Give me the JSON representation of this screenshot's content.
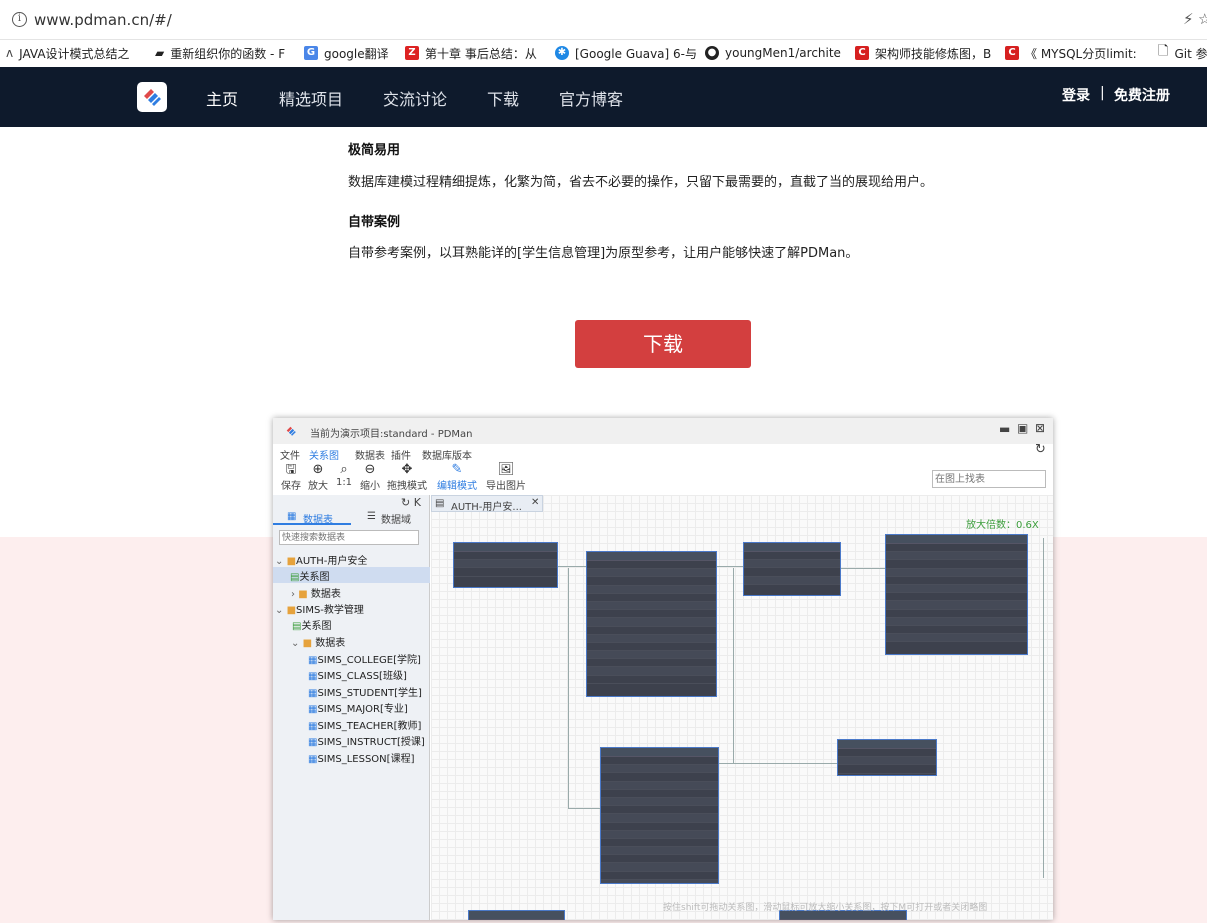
{
  "browser": {
    "url": "www.pdman.cn/#/",
    "bookmarks": [
      "JAVA设计模式总结之",
      "重新组织你的函数 - F",
      "google翻译",
      "第十章 事后总结：从",
      "[Google Guava] 6-与",
      "youngMen1/archite",
      "架构师技能修炼图，B",
      "《 MYSQL分页limit:",
      "Git 参"
    ]
  },
  "nav": {
    "items": [
      "主页",
      "精选项目",
      "交流讨论",
      "下载",
      "官方博客"
    ],
    "login": "登录",
    "sep": "|",
    "register": "免费注册"
  },
  "content": {
    "h1": "极简易用",
    "p1": "数据库建模过程精细提炼，化繁为简，省去不必要的操作，只留下最需要的，直截了当的展现给用户。",
    "h2": "自带案例",
    "p2": "自带参考案例，以耳熟能详的[学生信息管理]为原型参考，让用户能够快速了解PDMan。",
    "download": "下载"
  },
  "app": {
    "title": "当前为演示项目:standard - PDMan",
    "menus": [
      "文件",
      "关系图",
      "数据表",
      "插件",
      "数据库版本"
    ],
    "toolbar": [
      "保存",
      "放大",
      "1:1",
      "缩小",
      "拖拽模式",
      "编辑模式",
      "导出图片"
    ],
    "search_placeholder": "在图上找表",
    "tabs": [
      "数据表",
      "数据域"
    ],
    "tree_search_placeholder": "快速搜索数据表",
    "open_tab": "AUTH-用户安...",
    "zoom_label": "放大倍数：0.6X",
    "tree": [
      {
        "label": "AUTH-用户安全",
        "level": 0,
        "type": "folder"
      },
      {
        "label": "关系图",
        "level": 1,
        "type": "diagram",
        "selected": true
      },
      {
        "label": "数据表",
        "level": 1,
        "type": "folder"
      },
      {
        "label": "SIMS-教学管理",
        "level": 0,
        "type": "folder"
      },
      {
        "label": "关系图",
        "level": 1,
        "type": "diagram"
      },
      {
        "label": "数据表",
        "level": 1,
        "type": "folder"
      },
      {
        "label": "SIMS_COLLEGE[学院]",
        "level": 2,
        "type": "table"
      },
      {
        "label": "SIMS_CLASS[班级]",
        "level": 2,
        "type": "table"
      },
      {
        "label": "SIMS_STUDENT[学生]",
        "level": 2,
        "type": "table"
      },
      {
        "label": "SIMS_MAJOR[专业]",
        "level": 2,
        "type": "table"
      },
      {
        "label": "SIMS_TEACHER[教师]",
        "level": 2,
        "type": "table"
      },
      {
        "label": "SIMS_INSTRUCT[授课]",
        "level": 2,
        "type": "table"
      },
      {
        "label": "SIMS_LESSON[课程]",
        "level": 2,
        "type": "table"
      }
    ],
    "footer_hint": "按住shift可拖动关系图，滑动鼠标可放大缩小关系图，按下M可打开或者关闭略图",
    "diagram_tables": [
      {
        "name": "AUTH_ORG_PROPERTY",
        "rows": 3
      },
      {
        "name": "AUTH_ORG",
        "rows": 15
      },
      {
        "name": "AUTH_USER_ROLE",
        "rows": 4
      },
      {
        "name": "AUTH_ROLE",
        "rows": 12
      },
      {
        "name": "AUTH_USER",
        "rows": 16
      },
      {
        "name": "AUTH_USER_PERMIT",
        "rows": 3
      }
    ]
  }
}
